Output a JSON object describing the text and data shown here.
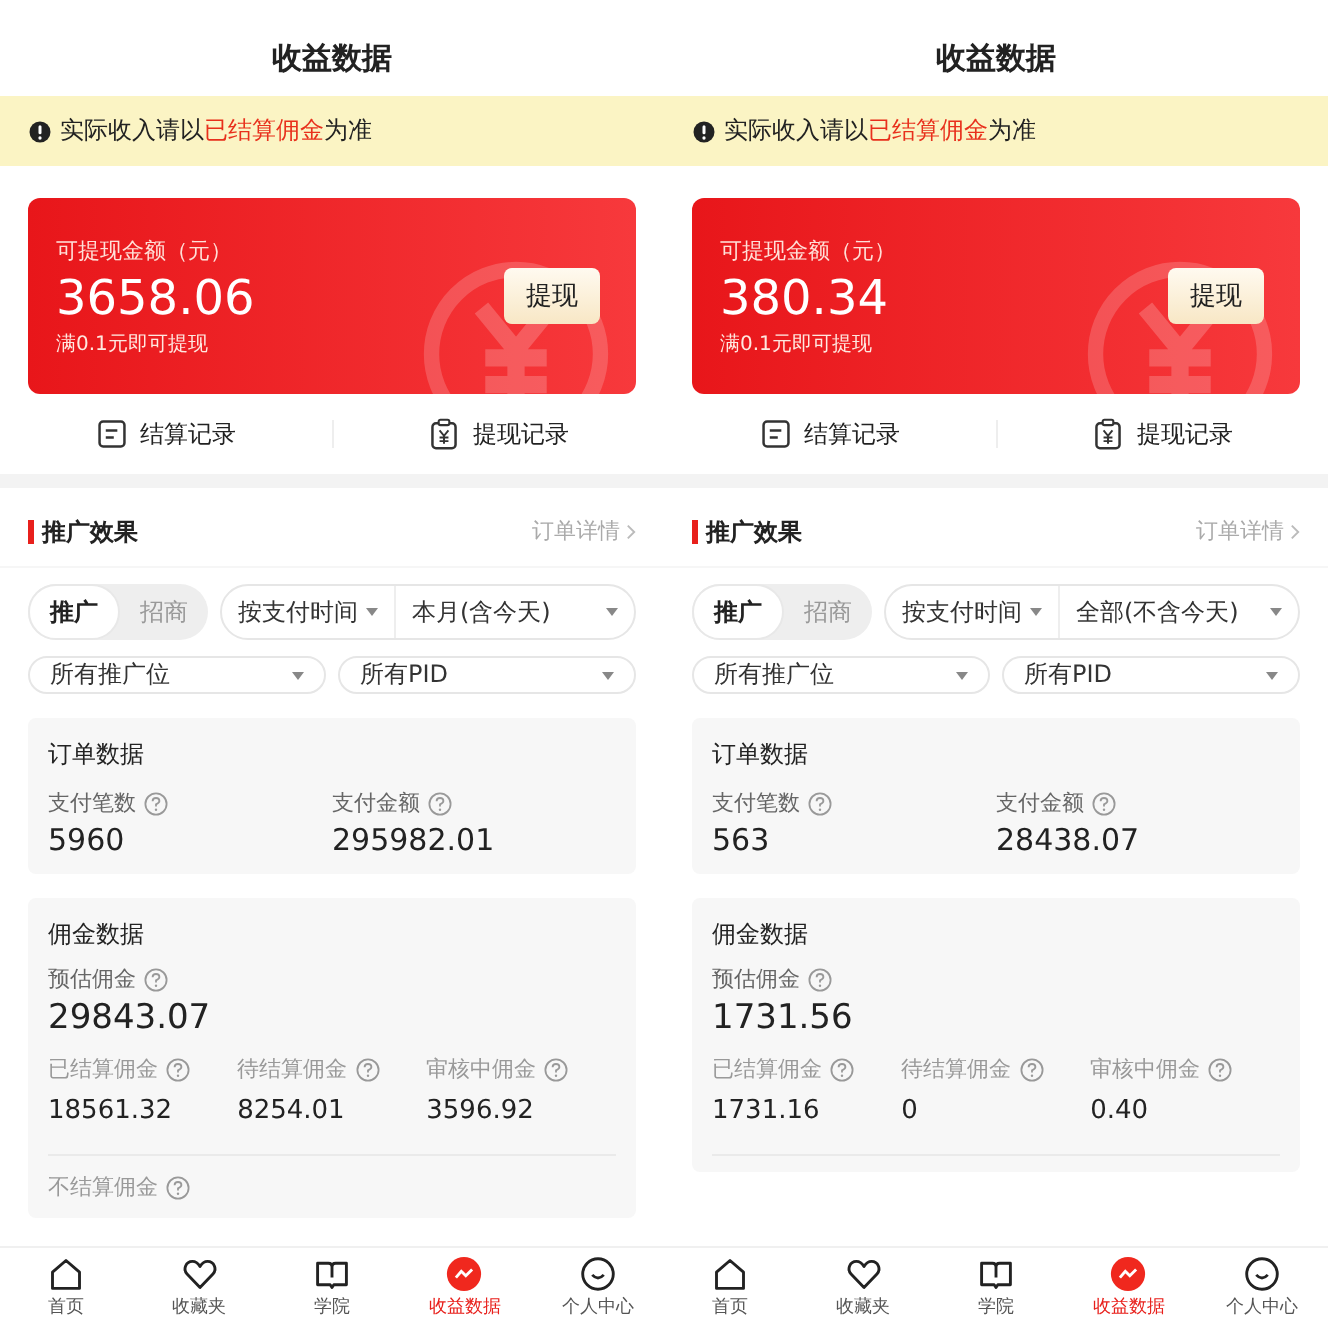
{
  "phones": [
    {
      "title": "收益数据",
      "notice": {
        "before": "实际收入请以",
        "highlight": "已结算佣金",
        "after": "为准"
      },
      "balance": {
        "label": "可提现金额（元）",
        "amount": "3658.06",
        "note": "满0.1元即可提现",
        "button": "提现"
      },
      "records": [
        "结算记录",
        "提现记录"
      ],
      "section": {
        "title": "推广效果",
        "link": "订单详情"
      },
      "toggle": [
        {
          "label": "推广",
          "selected": true
        },
        {
          "label": "招商",
          "selected": false
        }
      ],
      "time_filter": {
        "mode": "按支付时间",
        "range": "本月(含今天)"
      },
      "position_filter": "所有推广位",
      "pid_filter": "所有PID",
      "orders": {
        "title": "订单数据",
        "metrics": [
          {
            "label": "支付笔数",
            "value": "5960"
          },
          {
            "label": "支付金额",
            "value": "295982.01"
          }
        ]
      },
      "commission": {
        "title": "佣金数据",
        "estimate": {
          "label": "预估佣金",
          "value": "29843.07"
        },
        "metrics": [
          {
            "label": "已结算佣金",
            "value": "18561.32"
          },
          {
            "label": "待结算佣金",
            "value": "8254.01"
          },
          {
            "label": "审核中佣金",
            "value": "3596.92"
          }
        ],
        "next_label": "不结算佣金"
      },
      "tabs": [
        {
          "label": "首页",
          "selected": false
        },
        {
          "label": "收藏夹",
          "selected": false
        },
        {
          "label": "学院",
          "selected": false
        },
        {
          "label": "收益数据",
          "selected": true
        },
        {
          "label": "个人中心",
          "selected": false
        }
      ]
    },
    {
      "title": "收益数据",
      "notice": {
        "before": "实际收入请以",
        "highlight": "已结算佣金",
        "after": "为准"
      },
      "balance": {
        "label": "可提现金额（元）",
        "amount": "380.34",
        "note": "满0.1元即可提现",
        "button": "提现"
      },
      "records": [
        "结算记录",
        "提现记录"
      ],
      "section": {
        "title": "推广效果",
        "link": "订单详情"
      },
      "toggle": [
        {
          "label": "推广",
          "selected": true
        },
        {
          "label": "招商",
          "selected": false
        }
      ],
      "time_filter": {
        "mode": "按支付时间",
        "range": "全部(不含今天)"
      },
      "position_filter": "所有推广位",
      "pid_filter": "所有PID",
      "orders": {
        "title": "订单数据",
        "metrics": [
          {
            "label": "支付笔数",
            "value": "563"
          },
          {
            "label": "支付金额",
            "value": "28438.07"
          }
        ]
      },
      "commission": {
        "title": "佣金数据",
        "estimate": {
          "label": "预估佣金",
          "value": "1731.56"
        },
        "metrics": [
          {
            "label": "已结算佣金",
            "value": "1731.16"
          },
          {
            "label": "待结算佣金",
            "value": "0"
          },
          {
            "label": "审核中佣金",
            "value": "0.40"
          }
        ]
      },
      "tabs": [
        {
          "label": "首页",
          "selected": false
        },
        {
          "label": "收藏夹",
          "selected": false
        },
        {
          "label": "学院",
          "selected": false
        },
        {
          "label": "收益数据",
          "selected": true
        },
        {
          "label": "个人中心",
          "selected": false
        }
      ]
    }
  ]
}
